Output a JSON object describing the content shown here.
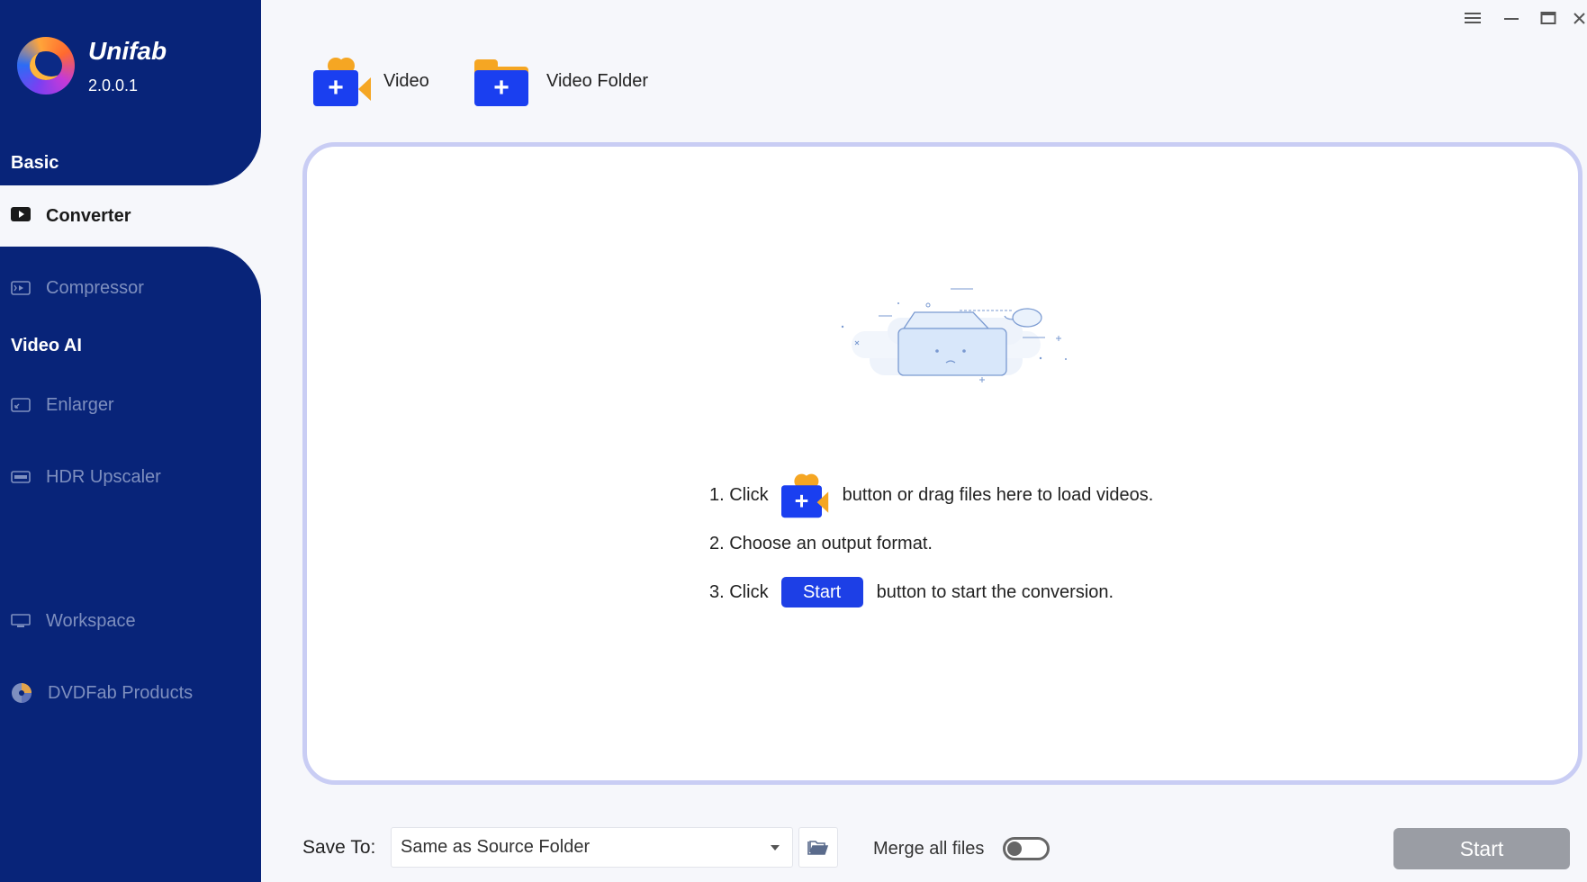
{
  "app": {
    "name": "Unifab",
    "version": "2.0.0.1"
  },
  "sidebar": {
    "sections": [
      {
        "title": "Basic"
      },
      {
        "title": "Video AI"
      }
    ],
    "items": [
      {
        "label": "Converter",
        "icon": "video-play-icon",
        "active": true
      },
      {
        "label": "Compressor",
        "icon": "compress-icon"
      },
      {
        "label": "Enlarger",
        "icon": "enlarge-icon"
      },
      {
        "label": "HDR Upscaler",
        "icon": "hdr-icon"
      },
      {
        "label": "Workspace",
        "icon": "monitor-icon"
      },
      {
        "label": "DVDFab Products",
        "icon": "dvdfab-icon"
      }
    ]
  },
  "toolbar": {
    "add_video_label": "Video",
    "add_folder_label": "Video Folder",
    "plus": "+"
  },
  "dropzone": {
    "step1_prefix": "1. Click",
    "step1_suffix": "button or drag files here to load videos.",
    "step2": "2. Choose an output format.",
    "step3_prefix": "3. Click",
    "step3_button": "Start",
    "step3_suffix": "button to start the conversion."
  },
  "bottom": {
    "save_to_label": "Save To:",
    "save_to_value": "Same as Source Folder",
    "merge_label": "Merge all files",
    "merge_enabled": false,
    "start_label": "Start"
  },
  "colors": {
    "sidebar_bg": "#082479",
    "accent_blue": "#1a3ff0",
    "accent_orange": "#f5a623",
    "disabled_button": "#9a9da4"
  }
}
